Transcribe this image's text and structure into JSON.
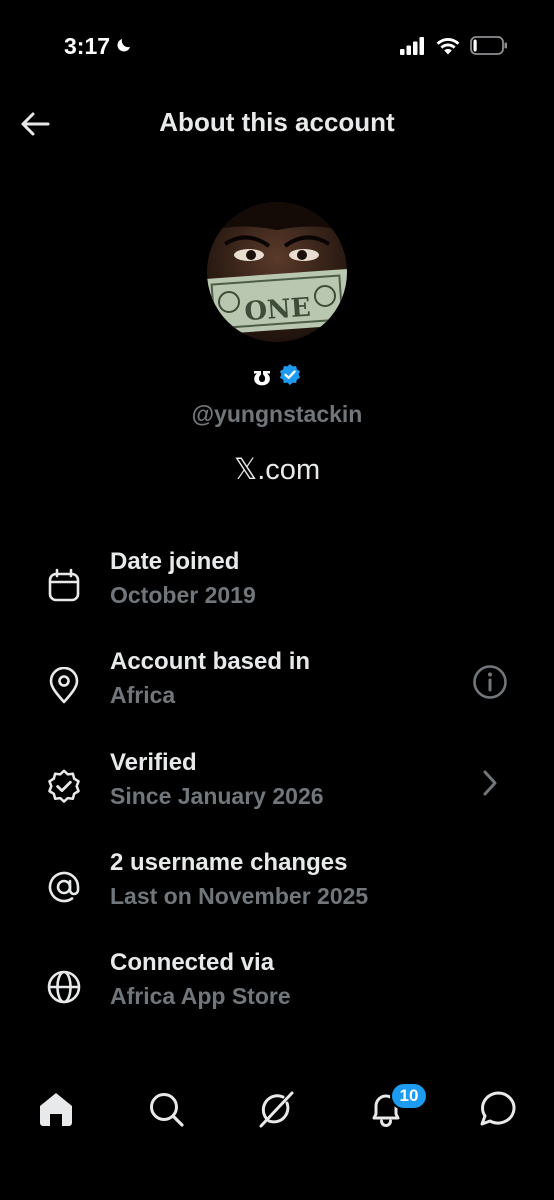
{
  "status_bar": {
    "time": "3:17",
    "moon_icon": "moon-icon",
    "signal_icon": "cellular-signal-icon",
    "wifi_icon": "wifi-icon",
    "battery_icon": "battery-icon",
    "battery_level": 0.12
  },
  "header": {
    "back_icon": "arrow-left-icon",
    "title": "About this account"
  },
  "profile": {
    "display_name": "ʊ",
    "verified_icon": "verified-badge-icon",
    "handle": "@yungnstackin",
    "site": "𝕏.com"
  },
  "rows": [
    {
      "icon": "calendar-icon",
      "title": "Date joined",
      "subtitle": "October 2019",
      "action_icon": ""
    },
    {
      "icon": "location-pin-icon",
      "title": "Account based in",
      "subtitle": "Africa",
      "action_icon": "info-icon"
    },
    {
      "icon": "verified-outline-icon",
      "title": "Verified",
      "subtitle": "Since January 2026",
      "action_icon": "chevron-right-icon"
    },
    {
      "icon": "at-sign-icon",
      "title": "2 username changes",
      "subtitle": "Last on November 2025",
      "action_icon": ""
    },
    {
      "icon": "globe-icon",
      "title": "Connected via",
      "subtitle": "Africa App Store",
      "action_icon": ""
    }
  ],
  "tab_bar": {
    "tabs": [
      "home-icon",
      "search-icon",
      "grok-icon",
      "bell-icon",
      "messages-icon"
    ],
    "notification_count": "10"
  },
  "colors": {
    "background": "#000000",
    "primary_text": "#e7e9ea",
    "secondary_text": "#71767b",
    "accent": "#1d9bf0"
  }
}
